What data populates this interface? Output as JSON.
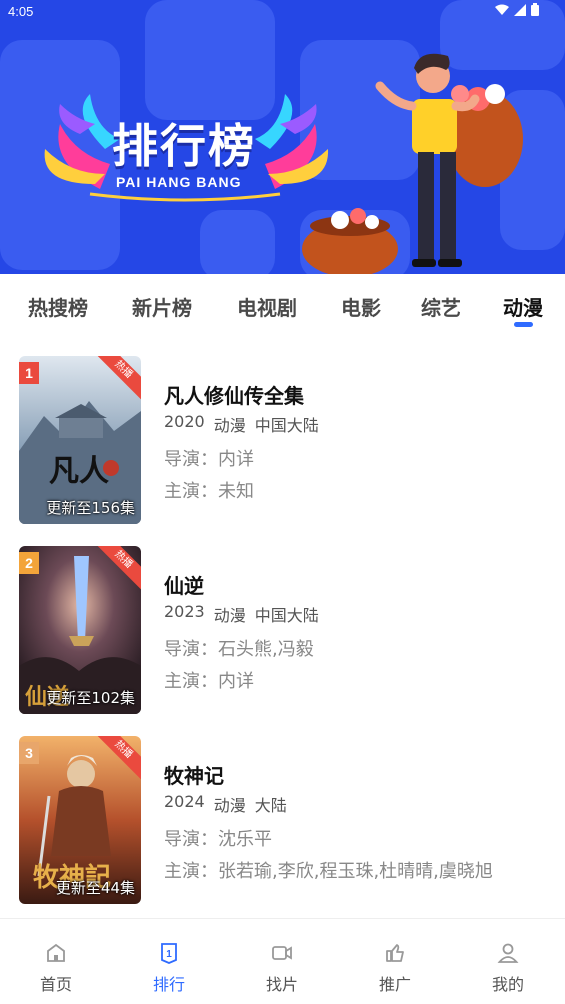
{
  "status_bar": {
    "time": "4:05"
  },
  "banner": {
    "title": "排行榜",
    "subtitle": "PAI HANG BANG"
  },
  "tabs": [
    {
      "label": "热搜榜"
    },
    {
      "label": "新片榜"
    },
    {
      "label": "电视剧"
    },
    {
      "label": "电影"
    },
    {
      "label": "综艺"
    },
    {
      "label": "动漫",
      "active": true
    }
  ],
  "list": [
    {
      "rank": "1",
      "badge": "热播",
      "update": "更新至156集",
      "title": "凡人修仙传全集",
      "year": "2020",
      "genre": "动漫",
      "region": "中国大陆",
      "director": "导演：内详",
      "cast": "主演：未知",
      "rank_color": "#ea4a3e"
    },
    {
      "rank": "2",
      "badge": "热播",
      "update": "更新至102集",
      "title": "仙逆",
      "year": "2023",
      "genre": "动漫",
      "region": "中国大陆",
      "director": "导演：石头熊,冯毅",
      "cast": "主演：内详",
      "rank_color": "#f3a43a"
    },
    {
      "rank": "3",
      "badge": "热播",
      "update": "更新至44集",
      "title": "牧神记",
      "year": "2024",
      "genre": "动漫",
      "region": "大陆",
      "director": "导演：沈乐平",
      "cast": "主演：张若瑜,李欣,程玉珠,杜晴晴,虞晓旭",
      "rank_color": "#e8a66b"
    }
  ],
  "bottom_nav": [
    {
      "label": "首页",
      "icon": "home-icon"
    },
    {
      "label": "排行",
      "icon": "ranking-icon",
      "active": true
    },
    {
      "label": "找片",
      "icon": "video-camera-icon"
    },
    {
      "label": "推广",
      "icon": "share-icon"
    },
    {
      "label": "我的",
      "icon": "user-icon"
    }
  ],
  "colors": {
    "accent": "#2f6bff",
    "banner": "#2547e6",
    "hot": "#ea4a3e"
  }
}
